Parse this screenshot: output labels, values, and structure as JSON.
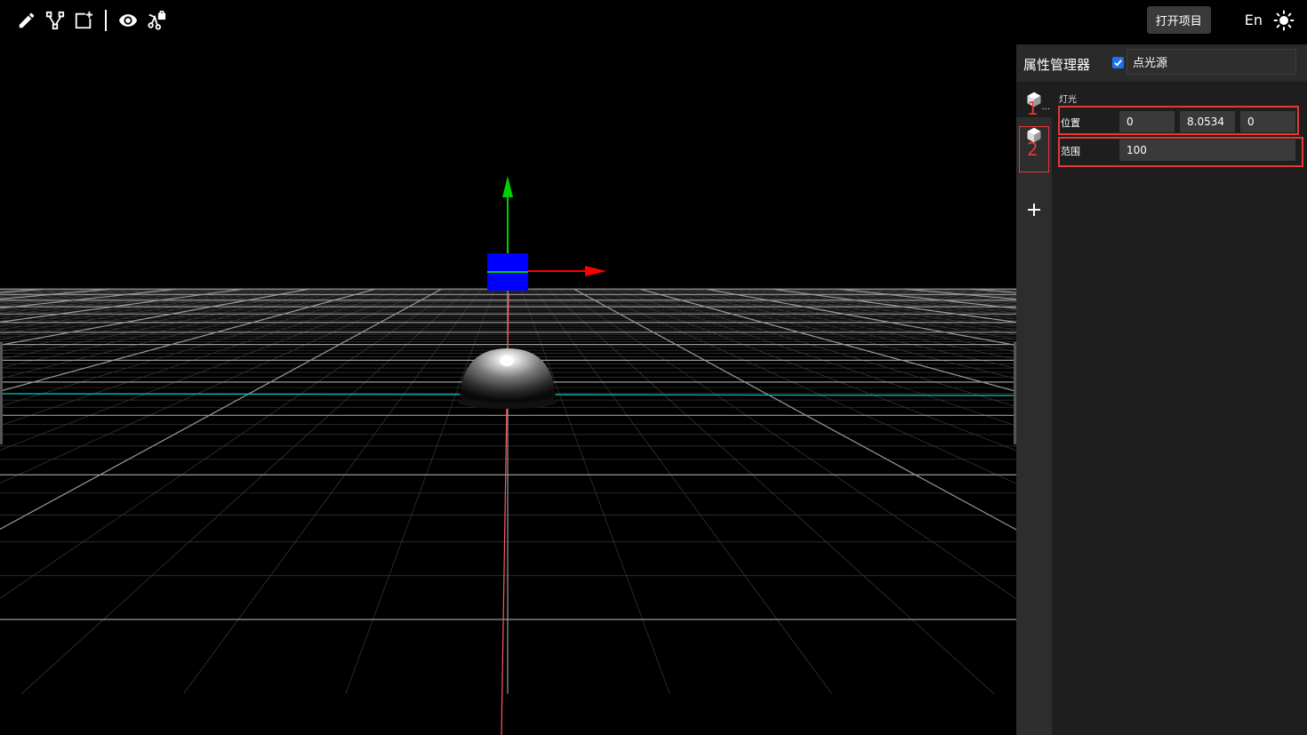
{
  "toolbar": {
    "icons": [
      "pencil-icon",
      "polyline-icon",
      "add-box-icon",
      "eye-icon",
      "lock-node-icon"
    ]
  },
  "header": {
    "open_project_label": "打开项目",
    "lang_label": "En",
    "theme_icon": "sun-icon"
  },
  "panel": {
    "title": "属性管理器",
    "visible_checked": true,
    "object_name": "点光源",
    "section_label": "灯光",
    "position_label": "位置",
    "position": {
      "x": "0",
      "y": "8.0534",
      "z": "0"
    },
    "range_label": "范围",
    "range_value": "100"
  },
  "tabs": [
    "cube-icon",
    "cube-icon"
  ],
  "annotations": {
    "label_1": "1",
    "label_2": "2",
    "color": "#e53935"
  },
  "colors": {
    "background": "#000000",
    "panel_bg": "#1e1e1e",
    "axis_x": "#ff0000",
    "axis_y": "#00cc00",
    "gizmo_blue": "#0000ff",
    "horizon_line": "#00c8c8",
    "checkbox": "#1a73e8"
  }
}
